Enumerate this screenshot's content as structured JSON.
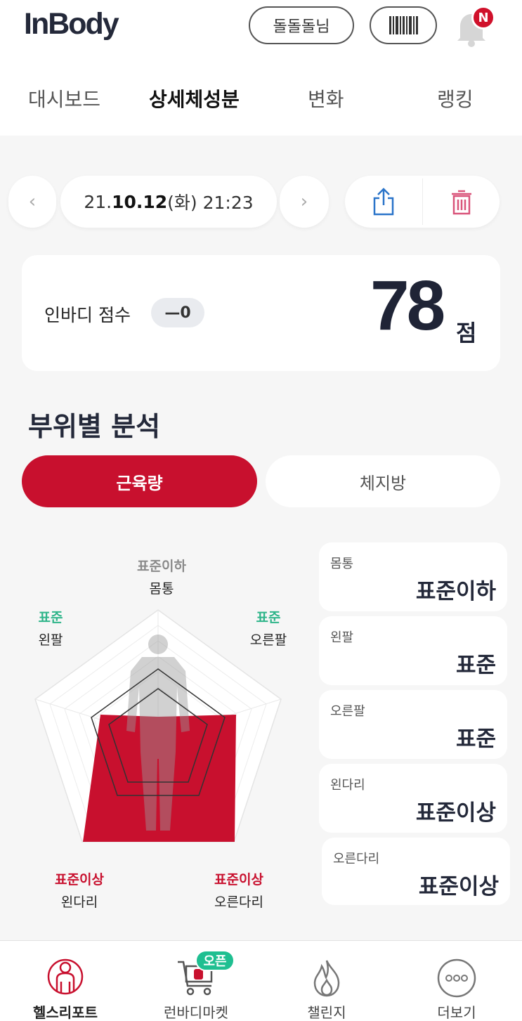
{
  "header": {
    "logo": "InBody",
    "user_button": "돌돌돌님",
    "notification_badge": "N"
  },
  "tabs": [
    {
      "label": "대시보드",
      "active": false
    },
    {
      "label": "상세체성분",
      "active": true
    },
    {
      "label": "변화",
      "active": false
    },
    {
      "label": "랭킹",
      "active": false
    }
  ],
  "date_nav": {
    "prefix": "21.",
    "date_bold": "10.12",
    "suffix": " (화) 21:23"
  },
  "score": {
    "label": "인바디 점수",
    "delta": "—0",
    "value": "78",
    "unit": "점"
  },
  "section": {
    "title": "부위별 분석"
  },
  "segment": {
    "muscle": "근육량",
    "fat": "체지방",
    "selected": "근육량"
  },
  "radar": {
    "labels": [
      {
        "part": "몸통",
        "status": "표준이하",
        "color": "#8a8a8a"
      },
      {
        "part": "왼팔",
        "status": "표준",
        "color": "#2fb58a"
      },
      {
        "part": "오른팔",
        "status": "표준",
        "color": "#2fb58a"
      },
      {
        "part": "왼다리",
        "status": "표준이상",
        "color": "#c8102e"
      },
      {
        "part": "오른다리",
        "status": "표준이상",
        "color": "#c8102e"
      }
    ]
  },
  "parts": [
    {
      "name": "몸통",
      "value": "표준이하"
    },
    {
      "name": "왼팔",
      "value": "표준"
    },
    {
      "name": "오른팔",
      "value": "표준"
    },
    {
      "name": "왼다리",
      "value": "표준이상"
    },
    {
      "name": "오른다리",
      "value": "표준이상"
    }
  ],
  "bottom_nav": [
    {
      "label": "헬스리포트",
      "icon": "health-report-icon",
      "active": true
    },
    {
      "label": "런바디마켓",
      "icon": "cart-icon",
      "active": false
    },
    {
      "label": "챌린지",
      "icon": "flame-icon",
      "active": false
    },
    {
      "label": "더보기",
      "icon": "more-icon",
      "active": false
    }
  ],
  "market_badge": "오픈",
  "colors": {
    "accent": "#c8102e",
    "standard_green": "#2fb58a",
    "badge_green": "#1fbf91",
    "text_dark": "#24293a"
  }
}
